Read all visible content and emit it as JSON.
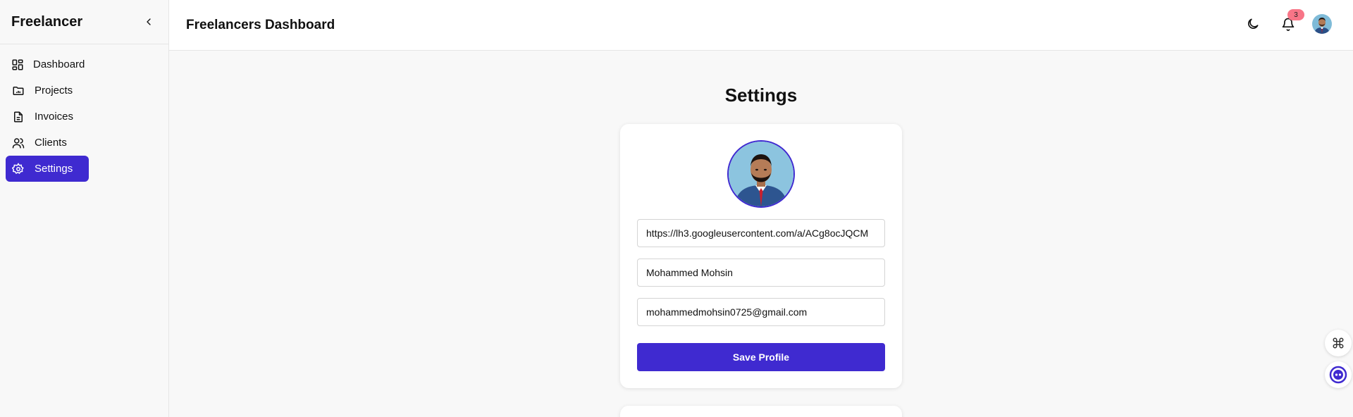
{
  "sidebar": {
    "brand": "Freelancer",
    "items": [
      {
        "label": "Dashboard",
        "icon": "dashboard-icon"
      },
      {
        "label": "Projects",
        "icon": "folder-icon"
      },
      {
        "label": "Invoices",
        "icon": "file-icon"
      },
      {
        "label": "Clients",
        "icon": "users-icon"
      },
      {
        "label": "Settings",
        "icon": "gear-icon",
        "active": true
      }
    ]
  },
  "header": {
    "title": "Freelancers Dashboard",
    "notification_count": "3"
  },
  "main": {
    "page_title": "Settings",
    "profile": {
      "photo_url": "https://lh3.googleusercontent.com/a/ACg8ocJQCM",
      "name": "Mohammed Mohsin",
      "email": "mohammedmohsin0725@gmail.com",
      "save_label": "Save Profile"
    }
  },
  "colors": {
    "accent": "#3f2ad0",
    "badge": "#f87587",
    "background": "#f8f8f8"
  }
}
